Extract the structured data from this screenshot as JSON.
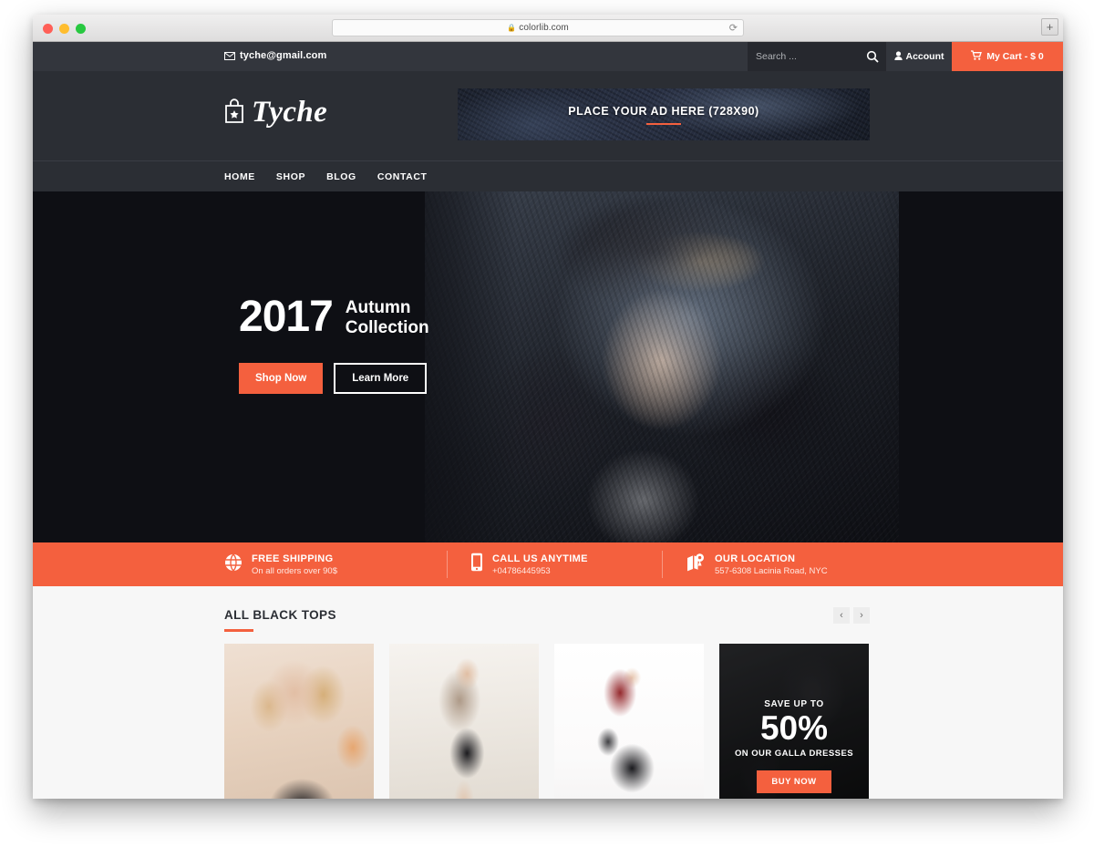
{
  "browser": {
    "url": "colorlib.com",
    "lock_icon": "lock-icon",
    "reload_icon": "reload-icon",
    "newtab_label": "+"
  },
  "topbar": {
    "email": "tyche@gmail.com",
    "email_icon": "envelope-icon",
    "search": {
      "placeholder": "Search ...",
      "value": "",
      "icon": "search-icon"
    },
    "account": {
      "label": "Account",
      "icon": "user-icon"
    },
    "cart": {
      "label": "My Cart - $ 0",
      "icon": "cart-icon"
    }
  },
  "header": {
    "logo_text": "Tyche",
    "logo_icon": "shopping-bag-star-icon",
    "ad": {
      "text": "PLACE YOUR AD HERE (728X90)"
    }
  },
  "nav": {
    "items": [
      {
        "label": "HOME"
      },
      {
        "label": "SHOP"
      },
      {
        "label": "BLOG"
      },
      {
        "label": "CONTACT"
      }
    ]
  },
  "hero": {
    "year": "2017",
    "subtitle_line1": "Autumn",
    "subtitle_line2": "Collection",
    "primary_button": "Shop Now",
    "secondary_button": "Learn More"
  },
  "features": [
    {
      "icon": "globe-icon",
      "title": "FREE SHIPPING",
      "text": "On all orders over 90$"
    },
    {
      "icon": "phone-icon",
      "title": "CALL US ANYTIME",
      "text": "+04786445953"
    },
    {
      "icon": "map-pin-icon",
      "title": "OUR LOCATION",
      "text": "557-6308 Lacinia Road, NYC"
    }
  ],
  "products_section": {
    "title": "ALL BLACK TOPS",
    "prev_label": "‹",
    "next_label": "›",
    "cards": [
      {
        "name": "product-card-1"
      },
      {
        "name": "product-card-2"
      },
      {
        "name": "product-card-3"
      }
    ],
    "promo": {
      "top_text": "SAVE UP TO",
      "big_text": "50%",
      "bottom_text": "ON OUR GALLA DRESSES",
      "button_label": "BUY NOW"
    }
  },
  "colors": {
    "accent": "#f4603e",
    "header_dark": "#2b2e34",
    "topbar_dark": "#33363d",
    "hero_dark": "#0e0f14",
    "page_bg": "#f7f7f7"
  }
}
